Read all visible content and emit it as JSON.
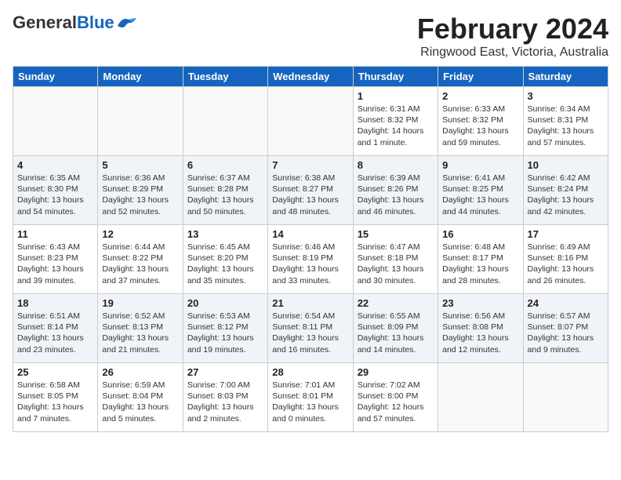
{
  "header": {
    "logo": {
      "general": "General",
      "blue": "Blue"
    },
    "title": "February 2024",
    "location": "Ringwood East, Victoria, Australia"
  },
  "weekdays": [
    "Sunday",
    "Monday",
    "Tuesday",
    "Wednesday",
    "Thursday",
    "Friday",
    "Saturday"
  ],
  "weeks": [
    [
      {
        "day": "",
        "info": ""
      },
      {
        "day": "",
        "info": ""
      },
      {
        "day": "",
        "info": ""
      },
      {
        "day": "",
        "info": ""
      },
      {
        "day": "1",
        "info": "Sunrise: 6:31 AM\nSunset: 8:32 PM\nDaylight: 14 hours\nand 1 minute."
      },
      {
        "day": "2",
        "info": "Sunrise: 6:33 AM\nSunset: 8:32 PM\nDaylight: 13 hours\nand 59 minutes."
      },
      {
        "day": "3",
        "info": "Sunrise: 6:34 AM\nSunset: 8:31 PM\nDaylight: 13 hours\nand 57 minutes."
      }
    ],
    [
      {
        "day": "4",
        "info": "Sunrise: 6:35 AM\nSunset: 8:30 PM\nDaylight: 13 hours\nand 54 minutes."
      },
      {
        "day": "5",
        "info": "Sunrise: 6:36 AM\nSunset: 8:29 PM\nDaylight: 13 hours\nand 52 minutes."
      },
      {
        "day": "6",
        "info": "Sunrise: 6:37 AM\nSunset: 8:28 PM\nDaylight: 13 hours\nand 50 minutes."
      },
      {
        "day": "7",
        "info": "Sunrise: 6:38 AM\nSunset: 8:27 PM\nDaylight: 13 hours\nand 48 minutes."
      },
      {
        "day": "8",
        "info": "Sunrise: 6:39 AM\nSunset: 8:26 PM\nDaylight: 13 hours\nand 46 minutes."
      },
      {
        "day": "9",
        "info": "Sunrise: 6:41 AM\nSunset: 8:25 PM\nDaylight: 13 hours\nand 44 minutes."
      },
      {
        "day": "10",
        "info": "Sunrise: 6:42 AM\nSunset: 8:24 PM\nDaylight: 13 hours\nand 42 minutes."
      }
    ],
    [
      {
        "day": "11",
        "info": "Sunrise: 6:43 AM\nSunset: 8:23 PM\nDaylight: 13 hours\nand 39 minutes."
      },
      {
        "day": "12",
        "info": "Sunrise: 6:44 AM\nSunset: 8:22 PM\nDaylight: 13 hours\nand 37 minutes."
      },
      {
        "day": "13",
        "info": "Sunrise: 6:45 AM\nSunset: 8:20 PM\nDaylight: 13 hours\nand 35 minutes."
      },
      {
        "day": "14",
        "info": "Sunrise: 6:46 AM\nSunset: 8:19 PM\nDaylight: 13 hours\nand 33 minutes."
      },
      {
        "day": "15",
        "info": "Sunrise: 6:47 AM\nSunset: 8:18 PM\nDaylight: 13 hours\nand 30 minutes."
      },
      {
        "day": "16",
        "info": "Sunrise: 6:48 AM\nSunset: 8:17 PM\nDaylight: 13 hours\nand 28 minutes."
      },
      {
        "day": "17",
        "info": "Sunrise: 6:49 AM\nSunset: 8:16 PM\nDaylight: 13 hours\nand 26 minutes."
      }
    ],
    [
      {
        "day": "18",
        "info": "Sunrise: 6:51 AM\nSunset: 8:14 PM\nDaylight: 13 hours\nand 23 minutes."
      },
      {
        "day": "19",
        "info": "Sunrise: 6:52 AM\nSunset: 8:13 PM\nDaylight: 13 hours\nand 21 minutes."
      },
      {
        "day": "20",
        "info": "Sunrise: 6:53 AM\nSunset: 8:12 PM\nDaylight: 13 hours\nand 19 minutes."
      },
      {
        "day": "21",
        "info": "Sunrise: 6:54 AM\nSunset: 8:11 PM\nDaylight: 13 hours\nand 16 minutes."
      },
      {
        "day": "22",
        "info": "Sunrise: 6:55 AM\nSunset: 8:09 PM\nDaylight: 13 hours\nand 14 minutes."
      },
      {
        "day": "23",
        "info": "Sunrise: 6:56 AM\nSunset: 8:08 PM\nDaylight: 13 hours\nand 12 minutes."
      },
      {
        "day": "24",
        "info": "Sunrise: 6:57 AM\nSunset: 8:07 PM\nDaylight: 13 hours\nand 9 minutes."
      }
    ],
    [
      {
        "day": "25",
        "info": "Sunrise: 6:58 AM\nSunset: 8:05 PM\nDaylight: 13 hours\nand 7 minutes."
      },
      {
        "day": "26",
        "info": "Sunrise: 6:59 AM\nSunset: 8:04 PM\nDaylight: 13 hours\nand 5 minutes."
      },
      {
        "day": "27",
        "info": "Sunrise: 7:00 AM\nSunset: 8:03 PM\nDaylight: 13 hours\nand 2 minutes."
      },
      {
        "day": "28",
        "info": "Sunrise: 7:01 AM\nSunset: 8:01 PM\nDaylight: 13 hours\nand 0 minutes."
      },
      {
        "day": "29",
        "info": "Sunrise: 7:02 AM\nSunset: 8:00 PM\nDaylight: 12 hours\nand 57 minutes."
      },
      {
        "day": "",
        "info": ""
      },
      {
        "day": "",
        "info": ""
      }
    ]
  ]
}
